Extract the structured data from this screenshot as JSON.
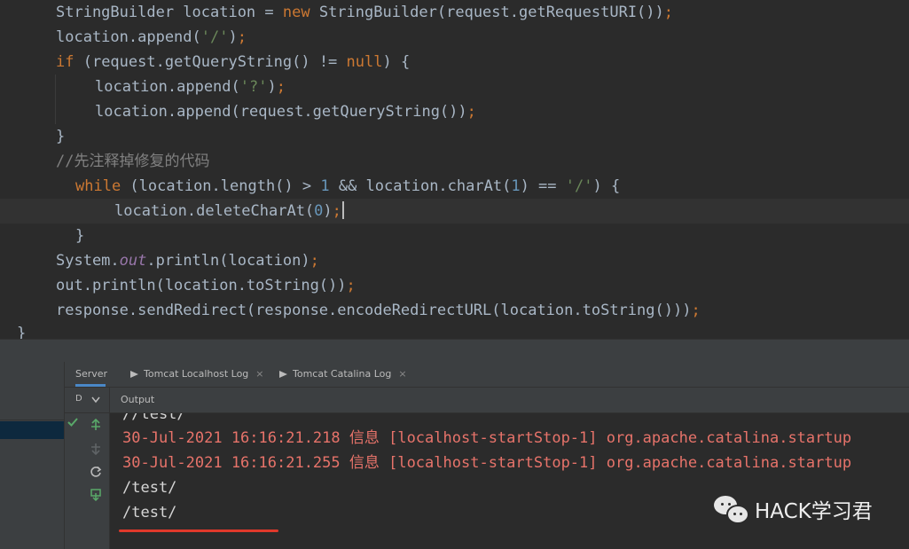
{
  "editor": {
    "lines": [
      {
        "segs": [
          {
            "c": "",
            "t": "StringBuilder location = "
          },
          {
            "c": "kw",
            "t": "new "
          },
          {
            "c": "",
            "t": "StringBuilder(request.getRequestURI())"
          },
          {
            "c": "kw",
            "t": ";"
          }
        ]
      },
      {
        "segs": [
          {
            "c": "",
            "t": "location.append("
          },
          {
            "c": "str",
            "t": "'/'"
          },
          {
            "c": "",
            "t": ")"
          },
          {
            "c": "kw",
            "t": ";"
          }
        ]
      },
      {
        "segs": [
          {
            "c": "kw",
            "t": "if "
          },
          {
            "c": "",
            "t": "(request.getQueryString() != "
          },
          {
            "c": "kw",
            "t": "null"
          },
          {
            "c": "",
            "t": ") {"
          }
        ]
      },
      {
        "segs": [
          {
            "c": "",
            "t": "location.append("
          },
          {
            "c": "str",
            "t": "'?'"
          },
          {
            "c": "",
            "t": ")"
          },
          {
            "c": "kw",
            "t": ";"
          }
        ]
      },
      {
        "segs": [
          {
            "c": "",
            "t": "location.append(request.getQueryString())"
          },
          {
            "c": "kw",
            "t": ";"
          }
        ]
      },
      {
        "segs": [
          {
            "c": "",
            "t": "}"
          }
        ]
      },
      {
        "segs": [
          {
            "c": "cmt",
            "t": "//先注释掉修复的代码"
          }
        ]
      },
      {
        "segs": [
          {
            "c": "kw",
            "t": "while "
          },
          {
            "c": "",
            "t": "(location.length() > "
          },
          {
            "c": "num",
            "t": "1"
          },
          {
            "c": "",
            "t": " && location.charAt("
          },
          {
            "c": "num",
            "t": "1"
          },
          {
            "c": "",
            "t": ") == "
          },
          {
            "c": "str",
            "t": "'/'"
          },
          {
            "c": "",
            "t": ") {"
          }
        ]
      },
      {
        "segs": [
          {
            "c": "",
            "t": "location.deleteCharAt("
          },
          {
            "c": "num",
            "t": "0"
          },
          {
            "c": "",
            "t": ")"
          },
          {
            "c": "kw",
            "t": ";"
          }
        ]
      },
      {
        "segs": [
          {
            "c": "",
            "t": "}"
          }
        ]
      },
      {
        "segs": [
          {
            "c": "",
            "t": "System."
          },
          {
            "c": "fld",
            "t": "out"
          },
          {
            "c": "",
            "t": ".println(location)"
          },
          {
            "c": "kw",
            "t": ";"
          }
        ]
      },
      {
        "segs": [
          {
            "c": "",
            "t": "out.println(location.toString())"
          },
          {
            "c": "kw",
            "t": ";"
          }
        ]
      },
      {
        "segs": [
          {
            "c": "",
            "t": "response.sendRedirect(response.encodeRedirectURL(location.toString()))"
          },
          {
            "c": "kw",
            "t": ";"
          }
        ]
      },
      {
        "segs": [
          {
            "c": "",
            "t": "}"
          }
        ]
      }
    ]
  },
  "tabs": {
    "server": "Server",
    "localhost_log": "Tomcat Localhost Log",
    "catalina_log": "Tomcat Catalina Log",
    "close_glyph": "×"
  },
  "subtabs": {
    "deploy_short": "D",
    "output": "Output"
  },
  "console": {
    "lines": [
      {
        "text": "//test/",
        "style": "normal"
      },
      {
        "text": "30-Jul-2021 16:16:21.218 信息 [localhost-startStop-1] org.apache.catalina.startup",
        "style": "err"
      },
      {
        "text": "30-Jul-2021 16:16:21.255 信息 [localhost-startStop-1] org.apache.catalina.startup",
        "style": "err"
      },
      {
        "text": "/test/",
        "style": "normal"
      },
      {
        "text": "/test/",
        "style": "normal"
      }
    ]
  },
  "watermark": {
    "text": "HACK学习君",
    "icon": "wechat-icon"
  },
  "colors": {
    "keyword": "#cc7832",
    "string": "#6a8759",
    "number": "#6897bb",
    "comment": "#808080",
    "error_output": "#e7736a",
    "underline": "#e0392b"
  }
}
